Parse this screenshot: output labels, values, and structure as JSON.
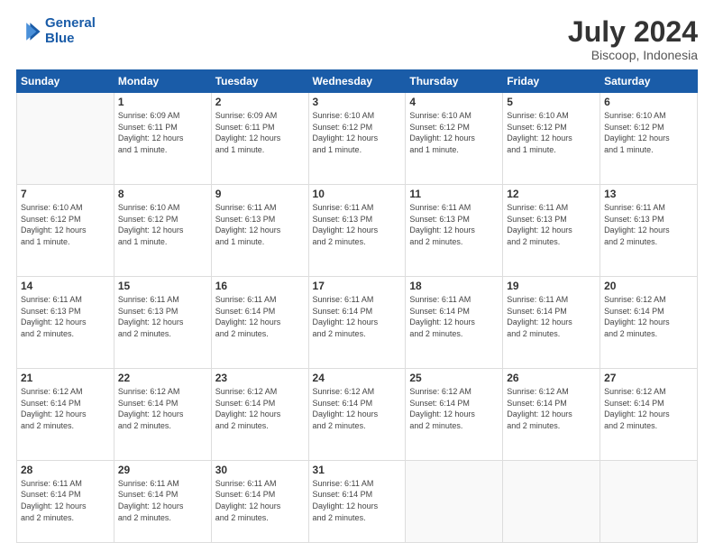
{
  "logo": {
    "line1": "General",
    "line2": "Blue"
  },
  "title": "July 2024",
  "subtitle": "Biscoop, Indonesia",
  "days_header": [
    "Sunday",
    "Monday",
    "Tuesday",
    "Wednesday",
    "Thursday",
    "Friday",
    "Saturday"
  ],
  "weeks": [
    [
      {
        "day": "",
        "info": ""
      },
      {
        "day": "1",
        "info": "Sunrise: 6:09 AM\nSunset: 6:11 PM\nDaylight: 12 hours\nand 1 minute."
      },
      {
        "day": "2",
        "info": "Sunrise: 6:09 AM\nSunset: 6:11 PM\nDaylight: 12 hours\nand 1 minute."
      },
      {
        "day": "3",
        "info": "Sunrise: 6:10 AM\nSunset: 6:12 PM\nDaylight: 12 hours\nand 1 minute."
      },
      {
        "day": "4",
        "info": "Sunrise: 6:10 AM\nSunset: 6:12 PM\nDaylight: 12 hours\nand 1 minute."
      },
      {
        "day": "5",
        "info": "Sunrise: 6:10 AM\nSunset: 6:12 PM\nDaylight: 12 hours\nand 1 minute."
      },
      {
        "day": "6",
        "info": "Sunrise: 6:10 AM\nSunset: 6:12 PM\nDaylight: 12 hours\nand 1 minute."
      }
    ],
    [
      {
        "day": "7",
        "info": "Sunrise: 6:10 AM\nSunset: 6:12 PM\nDaylight: 12 hours\nand 1 minute."
      },
      {
        "day": "8",
        "info": "Sunrise: 6:10 AM\nSunset: 6:12 PM\nDaylight: 12 hours\nand 1 minute."
      },
      {
        "day": "9",
        "info": "Sunrise: 6:11 AM\nSunset: 6:13 PM\nDaylight: 12 hours\nand 1 minute."
      },
      {
        "day": "10",
        "info": "Sunrise: 6:11 AM\nSunset: 6:13 PM\nDaylight: 12 hours\nand 2 minutes."
      },
      {
        "day": "11",
        "info": "Sunrise: 6:11 AM\nSunset: 6:13 PM\nDaylight: 12 hours\nand 2 minutes."
      },
      {
        "day": "12",
        "info": "Sunrise: 6:11 AM\nSunset: 6:13 PM\nDaylight: 12 hours\nand 2 minutes."
      },
      {
        "day": "13",
        "info": "Sunrise: 6:11 AM\nSunset: 6:13 PM\nDaylight: 12 hours\nand 2 minutes."
      }
    ],
    [
      {
        "day": "14",
        "info": "Sunrise: 6:11 AM\nSunset: 6:13 PM\nDaylight: 12 hours\nand 2 minutes."
      },
      {
        "day": "15",
        "info": "Sunrise: 6:11 AM\nSunset: 6:13 PM\nDaylight: 12 hours\nand 2 minutes."
      },
      {
        "day": "16",
        "info": "Sunrise: 6:11 AM\nSunset: 6:14 PM\nDaylight: 12 hours\nand 2 minutes."
      },
      {
        "day": "17",
        "info": "Sunrise: 6:11 AM\nSunset: 6:14 PM\nDaylight: 12 hours\nand 2 minutes."
      },
      {
        "day": "18",
        "info": "Sunrise: 6:11 AM\nSunset: 6:14 PM\nDaylight: 12 hours\nand 2 minutes."
      },
      {
        "day": "19",
        "info": "Sunrise: 6:11 AM\nSunset: 6:14 PM\nDaylight: 12 hours\nand 2 minutes."
      },
      {
        "day": "20",
        "info": "Sunrise: 6:12 AM\nSunset: 6:14 PM\nDaylight: 12 hours\nand 2 minutes."
      }
    ],
    [
      {
        "day": "21",
        "info": "Sunrise: 6:12 AM\nSunset: 6:14 PM\nDaylight: 12 hours\nand 2 minutes."
      },
      {
        "day": "22",
        "info": "Sunrise: 6:12 AM\nSunset: 6:14 PM\nDaylight: 12 hours\nand 2 minutes."
      },
      {
        "day": "23",
        "info": "Sunrise: 6:12 AM\nSunset: 6:14 PM\nDaylight: 12 hours\nand 2 minutes."
      },
      {
        "day": "24",
        "info": "Sunrise: 6:12 AM\nSunset: 6:14 PM\nDaylight: 12 hours\nand 2 minutes."
      },
      {
        "day": "25",
        "info": "Sunrise: 6:12 AM\nSunset: 6:14 PM\nDaylight: 12 hours\nand 2 minutes."
      },
      {
        "day": "26",
        "info": "Sunrise: 6:12 AM\nSunset: 6:14 PM\nDaylight: 12 hours\nand 2 minutes."
      },
      {
        "day": "27",
        "info": "Sunrise: 6:12 AM\nSunset: 6:14 PM\nDaylight: 12 hours\nand 2 minutes."
      }
    ],
    [
      {
        "day": "28",
        "info": "Sunrise: 6:11 AM\nSunset: 6:14 PM\nDaylight: 12 hours\nand 2 minutes."
      },
      {
        "day": "29",
        "info": "Sunrise: 6:11 AM\nSunset: 6:14 PM\nDaylight: 12 hours\nand 2 minutes."
      },
      {
        "day": "30",
        "info": "Sunrise: 6:11 AM\nSunset: 6:14 PM\nDaylight: 12 hours\nand 2 minutes."
      },
      {
        "day": "31",
        "info": "Sunrise: 6:11 AM\nSunset: 6:14 PM\nDaylight: 12 hours\nand 2 minutes."
      },
      {
        "day": "",
        "info": ""
      },
      {
        "day": "",
        "info": ""
      },
      {
        "day": "",
        "info": ""
      }
    ]
  ]
}
